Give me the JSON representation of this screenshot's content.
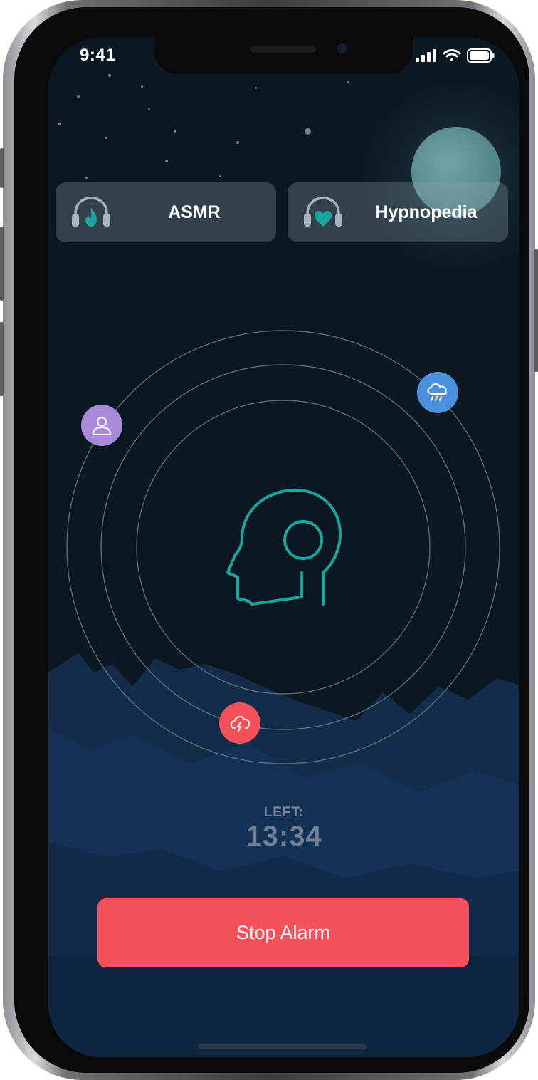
{
  "statusbar": {
    "time": "9:41",
    "icons": [
      "cellular-signal-icon",
      "wifi-icon",
      "battery-icon"
    ]
  },
  "cards": [
    {
      "label": "ASMR",
      "icon": "headphones-flame-icon"
    },
    {
      "label": "Hypnopedia",
      "icon": "headphones-heart-icon"
    }
  ],
  "orbit": {
    "center_icon": "head-with-headphones-icon",
    "icons": [
      {
        "name": "user-icon",
        "color": "#a88ad8"
      },
      {
        "name": "rain-cloud-icon",
        "color": "#4a90dd"
      },
      {
        "name": "storm-cloud-icon",
        "color": "#f4515a"
      }
    ]
  },
  "timer": {
    "label": "LEFT:",
    "value": "13:34"
  },
  "actions": {
    "stop_label": "Stop Alarm"
  },
  "colors": {
    "background": "#0b1821",
    "accent_teal": "#1aa6a0",
    "stop_button": "#f4515a",
    "mountains": "#173659"
  }
}
